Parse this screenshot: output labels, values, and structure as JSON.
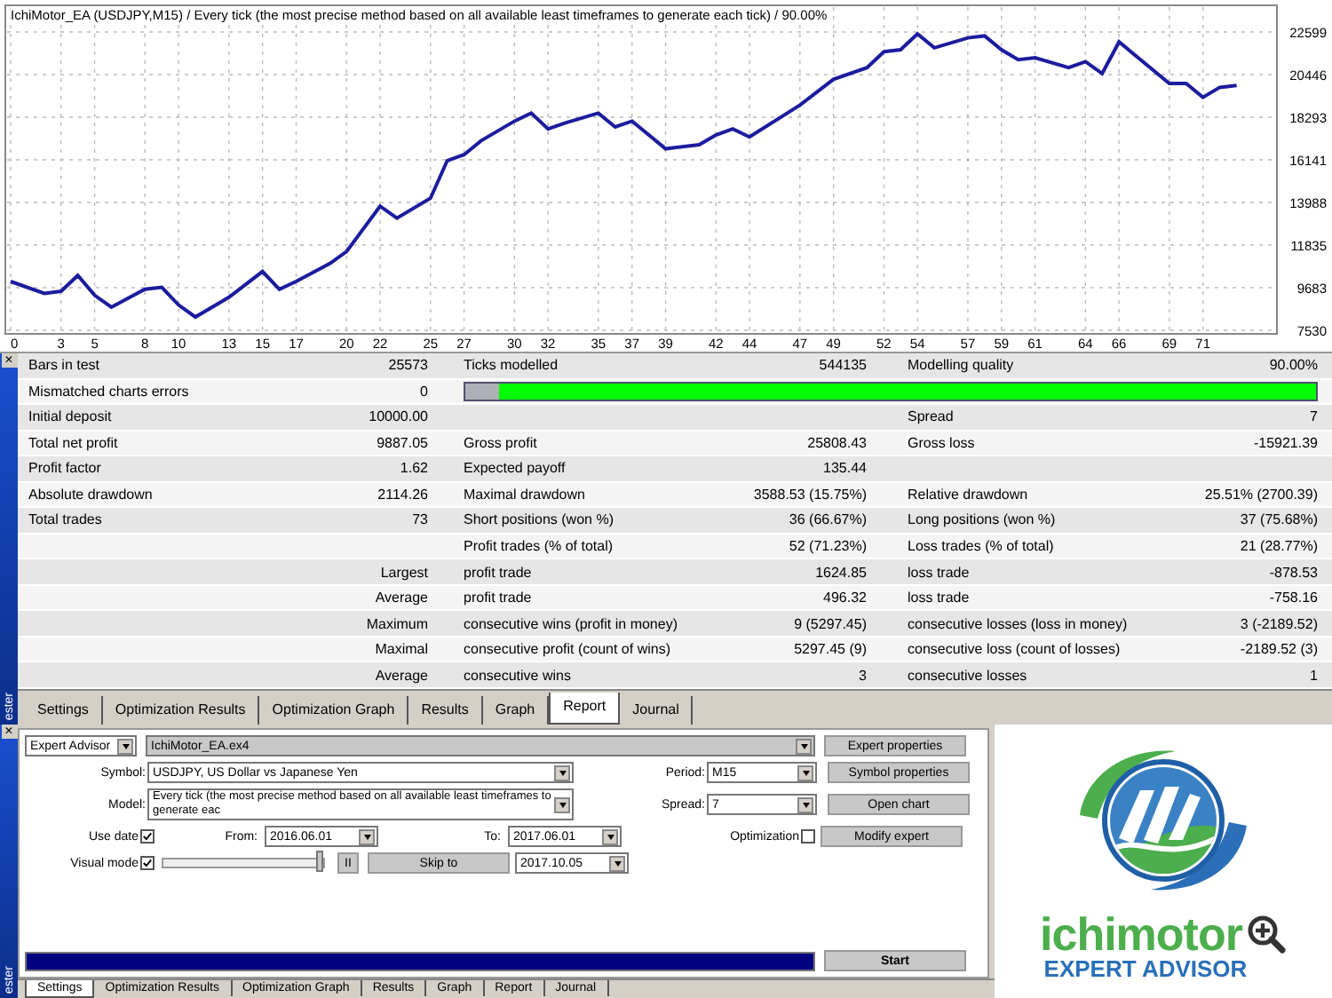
{
  "chart": {
    "title": "IchiMotor_EA (USDJPY,M15) / Every tick (the most precise method based on all available least timeframes to generate each tick) / 90.00%",
    "chart_data": {
      "type": "line",
      "xlim": [
        0,
        75.3
      ],
      "ylim": [
        7530,
        22599
      ],
      "xticks": [
        0,
        3,
        5,
        8,
        10,
        13,
        15,
        17,
        20,
        22,
        25,
        27,
        30,
        32,
        35,
        37,
        39,
        42,
        44,
        47,
        49,
        52,
        54,
        57,
        59,
        61,
        64,
        66,
        69,
        71
      ],
      "yticks": [
        7530,
        9683,
        11835,
        13988,
        16141,
        18293,
        20446,
        22599
      ],
      "x": [
        0,
        2,
        3,
        4,
        5,
        6,
        8,
        9,
        10,
        11,
        13,
        15,
        16,
        17,
        19,
        20,
        22,
        23,
        25,
        26,
        27,
        28,
        30,
        31,
        32,
        33,
        35,
        36,
        37,
        39,
        41,
        42,
        43,
        44,
        47,
        49,
        51,
        52,
        53,
        54,
        55,
        57,
        58,
        59,
        60,
        61,
        63,
        64,
        65,
        66,
        69,
        70,
        71,
        72,
        73
      ],
      "grid": true,
      "series": [
        {
          "color": "#1c1c9e",
          "values": [
            10000,
            9400,
            9500,
            10300,
            9300,
            8700,
            9600,
            9700,
            8800,
            8200,
            9200,
            10500,
            9600,
            10000,
            10900,
            11500,
            13800,
            13200,
            14200,
            16100,
            16400,
            17100,
            18100,
            18500,
            17700,
            18000,
            18500,
            17800,
            18100,
            16700,
            16900,
            17400,
            17700,
            17300,
            18900,
            20200,
            20800,
            21600,
            21700,
            22500,
            21800,
            22300,
            22400,
            21700,
            21200,
            21300,
            20800,
            21100,
            20500,
            22100,
            20000,
            20000,
            19300,
            19800,
            19900
          ]
        }
      ]
    }
  },
  "report": {
    "rows": [
      {
        "kind": "stat",
        "label_1": "Bars in test",
        "value_1": "25573",
        "label_2": "Ticks modelled",
        "value_2": "544135",
        "label_3": "Modelling quality",
        "value_3": "90.00%"
      },
      {
        "kind": "quality",
        "label_1": "Mismatched charts errors",
        "value_1": "0",
        "level": 0.96
      },
      {
        "kind": "stat",
        "label_1": "Initial deposit",
        "value_1": "10000.00",
        "label_3": "Spread",
        "value_3": "7"
      },
      {
        "kind": "stat",
        "label_1": "Total net profit",
        "value_1": "9887.05",
        "label_2": "Gross profit",
        "value_2": "25808.43",
        "label_3": "Gross loss",
        "value_3": "-15921.39"
      },
      {
        "kind": "stat",
        "label_1": "Profit factor",
        "value_1": "1.62",
        "label_2": "Expected payoff",
        "value_2": "135.44"
      },
      {
        "kind": "stat",
        "label_1": "Absolute drawdown",
        "value_1": "2114.26",
        "label_2": "Maximal drawdown",
        "value_2": "3588.53 (15.75%)",
        "label_3": "Relative drawdown",
        "value_3": "25.51% (2700.39)"
      },
      {
        "kind": "stat",
        "label_1": "Total trades",
        "value_1": "73",
        "label_2": "Short positions (won %)",
        "value_2": "36 (66.67%)",
        "label_3": "Long positions (won %)",
        "value_3": "37 (75.68%)"
      },
      {
        "kind": "stat",
        "label_2": "Profit trades (% of total)",
        "value_2": "52 (71.23%)",
        "label_3": "Loss trades (% of total)",
        "value_3": "21 (28.77%)"
      },
      {
        "kind": "group",
        "label_1": "Largest",
        "label_2": "profit trade",
        "value_2": "1624.85",
        "label_3": "loss trade",
        "value_3": "-878.53"
      },
      {
        "kind": "group",
        "label_1": "Average",
        "label_2": "profit trade",
        "value_2": "496.32",
        "label_3": "loss trade",
        "value_3": "-758.16"
      },
      {
        "kind": "group",
        "label_1": "Maximum",
        "label_2": "consecutive wins (profit in money)",
        "value_2": "9 (5297.45)",
        "label_3": "consecutive losses (loss in money)",
        "value_3": "3 (-2189.52)"
      },
      {
        "kind": "group",
        "label_1": "Maximal",
        "label_2": "consecutive profit (count of wins)",
        "value_2": "5297.45 (9)",
        "label_3": "consecutive loss (count of losses)",
        "value_3": "-2189.52 (3)"
      },
      {
        "kind": "group",
        "label_1": "Average",
        "label_2": "consecutive wins",
        "value_2": "3",
        "label_3": "consecutive losses",
        "value_3": "1"
      }
    ],
    "side_label": "ester",
    "close_label": "×",
    "tabs": [
      {
        "label": "Settings",
        "selected": false
      },
      {
        "label": "Optimization Results",
        "selected": false
      },
      {
        "label": "Optimization Graph",
        "selected": false
      },
      {
        "label": "Results",
        "selected": false
      },
      {
        "label": "Graph",
        "selected": false
      },
      {
        "label": "Report",
        "selected": true
      },
      {
        "label": "Journal",
        "selected": false
      }
    ]
  },
  "settings": {
    "program_type": "Expert Advisor",
    "program_file": "IchiMotor_EA.ex4",
    "symbol": {
      "label": "Symbol:",
      "value": "USDJPY, US Dollar vs Japanese Yen"
    },
    "period": {
      "label": "Period:",
      "value": "M15"
    },
    "model": {
      "label": "Model:",
      "value": "Every tick (the most precise method based on all available least timeframes to generate eac"
    },
    "spread": {
      "label": "Spread:",
      "value": "7"
    },
    "use_date": {
      "label": "Use date",
      "checked": true
    },
    "from": {
      "label": "From:",
      "value": "2016.06.01"
    },
    "to": {
      "label": "To:",
      "value": "2017.06.01"
    },
    "optimization": {
      "label": "Optimization",
      "checked": false
    },
    "visual_mode": {
      "label": "Visual mode",
      "checked": true
    },
    "visual_speed": {
      "level": 1
    },
    "pause_button": "II",
    "skip_button": "Skip to",
    "skip_date": "2017.10.05",
    "buttons": [
      "Expert properties",
      "Symbol properties",
      "Open chart",
      "Modify expert"
    ],
    "progress": {
      "level": 1
    },
    "start_button": "Start",
    "side_label": "ester",
    "close_label": "×",
    "tabs": [
      {
        "label": "Settings",
        "selected": true
      },
      {
        "label": "Optimization Results",
        "selected": false
      },
      {
        "label": "Optimization Graph",
        "selected": false
      },
      {
        "label": "Results",
        "selected": false
      },
      {
        "label": "Graph",
        "selected": false
      },
      {
        "label": "Report",
        "selected": false
      },
      {
        "label": "Journal",
        "selected": false
      }
    ]
  },
  "logo": {
    "name": "ichimotor",
    "subtitle": "EXPERT ADVISOR"
  }
}
